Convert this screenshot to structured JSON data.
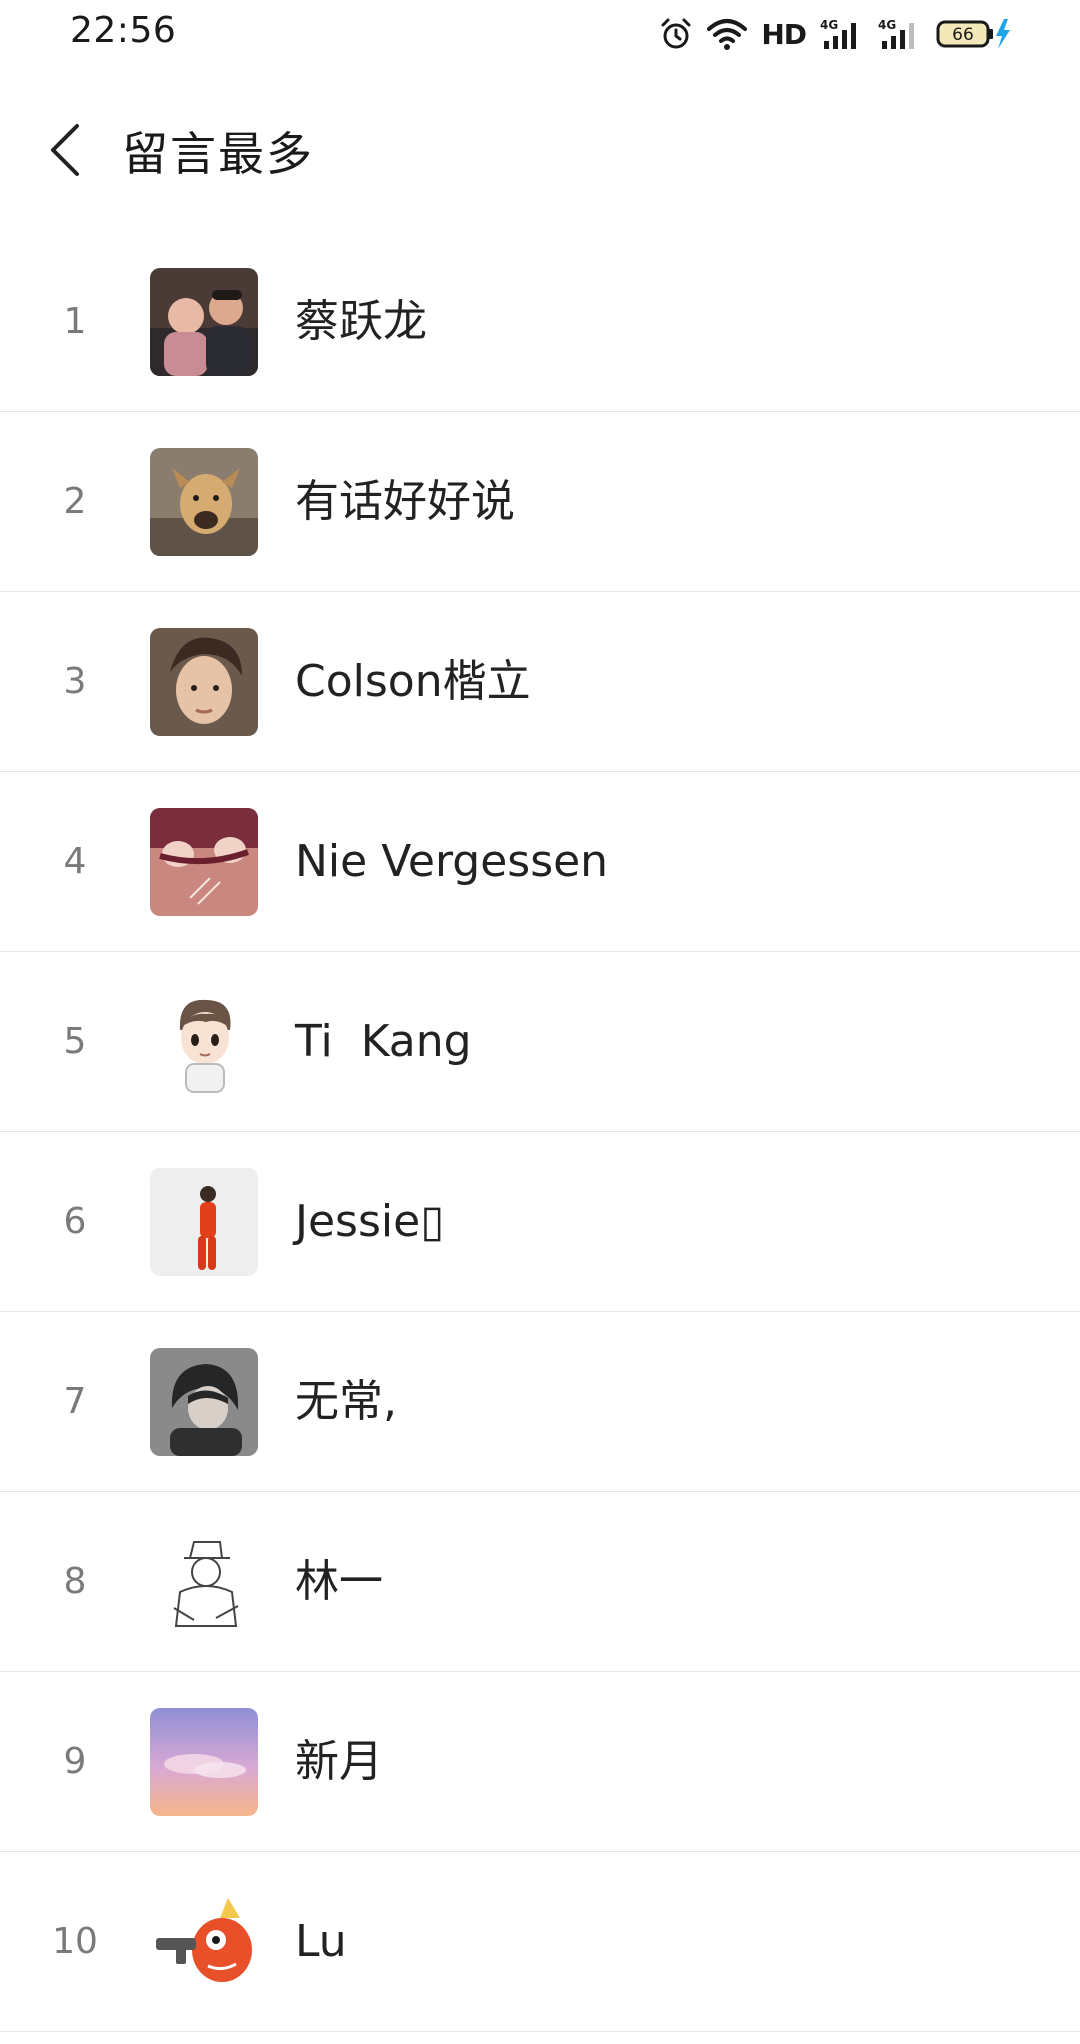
{
  "status_bar": {
    "time": "22:56",
    "hd_label": "HD",
    "network_1": "4G",
    "network_2": "4G",
    "battery": "66"
  },
  "header": {
    "title": "留言最多"
  },
  "list": [
    {
      "rank": "1",
      "name": "蔡跃龙"
    },
    {
      "rank": "2",
      "name": "有话好好说"
    },
    {
      "rank": "3",
      "name": "Colson楷立"
    },
    {
      "rank": "4",
      "name": "Nie Vergessen"
    },
    {
      "rank": "5",
      "name": "Ti  Kang"
    },
    {
      "rank": "6",
      "name": "Jessie▯"
    },
    {
      "rank": "7",
      "name": "无常,"
    },
    {
      "rank": "8",
      "name": "林一"
    },
    {
      "rank": "9",
      "name": "新月"
    },
    {
      "rank": "10",
      "name": "Lu"
    }
  ]
}
